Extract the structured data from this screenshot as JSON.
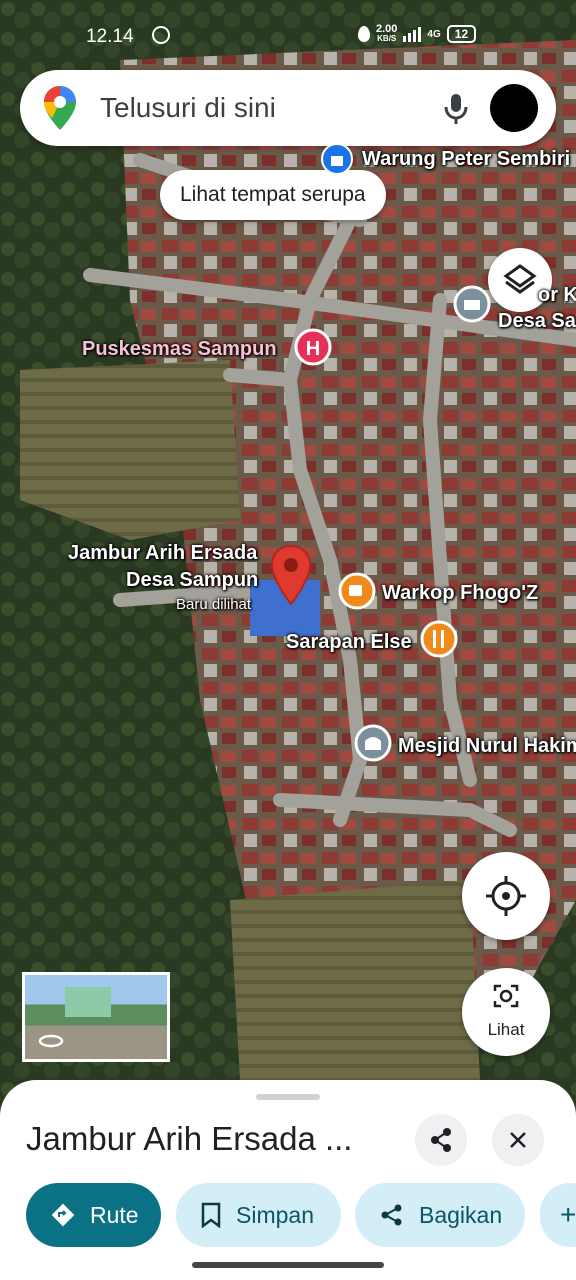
{
  "status_bar": {
    "time": "12.14",
    "net_speed": "2.00",
    "net_unit": "KB/S",
    "net_type": "4G",
    "battery": "12"
  },
  "search": {
    "placeholder": "Telusuri di sini"
  },
  "chip": {
    "label": "Lihat tempat serupa"
  },
  "places": [
    {
      "name": "Warung Peter Sembiri",
      "icon": "shopping-bag-icon"
    },
    {
      "name": "or K",
      "icon": "government-building-icon"
    },
    {
      "name": "Desa Sa",
      "icon": "government-building-icon"
    },
    {
      "name": "Puskesmas Sampun",
      "icon": "hospital-icon"
    },
    {
      "name": "Warkop Fhogo'Z",
      "icon": "coffee-icon"
    },
    {
      "name": "Sarapan Else",
      "icon": "restaurant-icon"
    },
    {
      "name": "Mesjid Nurul Hakim",
      "icon": "mosque-icon"
    }
  ],
  "selected": {
    "name_line1": "Jambur Arih Ersada",
    "name_line2": "Desa Sampun",
    "subtitle": "Baru dilihat"
  },
  "controls": {
    "layers_icon": "layers-icon",
    "locate_icon": "my-location-icon",
    "lens_icon": "camera-lens-icon",
    "lens_label": "Lihat"
  },
  "sheet": {
    "title": "Jambur Arih Ersada ...",
    "actions": [
      {
        "label": "Rute",
        "icon": "directions-icon"
      },
      {
        "label": "Simpan",
        "icon": "bookmark-icon"
      },
      {
        "label": "Bagikan",
        "icon": "share-icon"
      },
      {
        "label": "+",
        "icon": "add-icon"
      }
    ]
  },
  "colors": {
    "accent": "#0b7285",
    "pin_red": "#e03a2f",
    "hospital_pink": "#f7c3d3",
    "food_orange": "#f08a1c",
    "chip_light": "#d3eef6"
  }
}
